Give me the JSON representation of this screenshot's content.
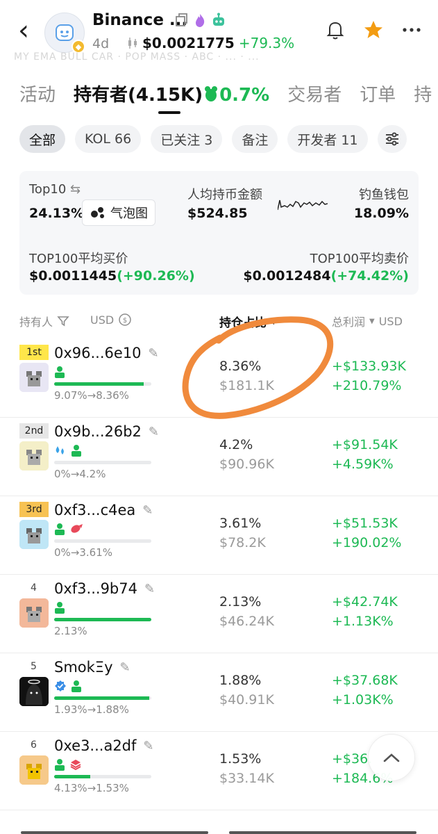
{
  "header": {
    "token_name": "Binance ...",
    "age": "4d",
    "price": "$0.0021775",
    "change": "+79.3%",
    "ghost_text": "MY EMA BULL CAR · POP MASS · ABC · ... · ..."
  },
  "tabs": [
    {
      "label": "活动"
    },
    {
      "label": "持有者(4.15K)",
      "pct": "0.7%"
    },
    {
      "label": "交易者"
    },
    {
      "label": "订单"
    },
    {
      "label": "持"
    }
  ],
  "chips": [
    {
      "label": "全部"
    },
    {
      "label": "KOL 66"
    },
    {
      "label": "已关注 3"
    },
    {
      "label": "备注"
    },
    {
      "label": "开发者 11"
    }
  ],
  "stats": {
    "top10_label": "Top10",
    "top10_value": "24.13%",
    "bubble_label": "气泡图",
    "avg_hold_label": "人均持币金额",
    "avg_hold_value": "$524.85",
    "phishing_label": "钓鱼钱包",
    "phishing_value": "18.09%",
    "top100_buy_label": "TOP100平均买价",
    "top100_buy_value": "$0.0011445",
    "top100_buy_change": "(+90.26%)",
    "top100_sell_label": "TOP100平均卖价",
    "top100_sell_value": "$0.0012484",
    "top100_sell_change": "(+74.42%)"
  },
  "table_header": {
    "holder": "持有人",
    "usd": "USD",
    "position": "持仓占比",
    "pnl": "总利润",
    "pnl_usd": "USD"
  },
  "rows": [
    {
      "rank": "1st",
      "address": "0x96...6e10",
      "change": "9.07%→8.36%",
      "hold_pct": "8.36%",
      "hold_usd": "$181.1K",
      "pnl": "+$133.93K",
      "pnl_pct": "+210.79%",
      "bar": 0.92
    },
    {
      "rank": "2nd",
      "address": "0x9b...26b2",
      "change": "0%→4.2%",
      "hold_pct": "4.2%",
      "hold_usd": "$90.96K",
      "pnl": "+$91.54K",
      "pnl_pct": "+4.59K%",
      "bar": 0.0
    },
    {
      "rank": "3rd",
      "address": "0xf3...c4ea",
      "change": "0%→3.61%",
      "hold_pct": "3.61%",
      "hold_usd": "$78.2K",
      "pnl": "+$51.53K",
      "pnl_pct": "+190.02%",
      "bar": 0.0
    },
    {
      "rank": "4",
      "address": "0xf3...9b74",
      "change": "2.13%",
      "hold_pct": "2.13%",
      "hold_usd": "$46.24K",
      "pnl": "+$42.74K",
      "pnl_pct": "+1.13K%",
      "bar": 1.0
    },
    {
      "rank": "5",
      "address": "SmokΞy",
      "change": "1.93%→1.88%",
      "hold_pct": "1.88%",
      "hold_usd": "$40.91K",
      "pnl": "+$37.68K",
      "pnl_pct": "+1.03K%",
      "bar": 0.98
    },
    {
      "rank": "6",
      "address": "0xe3...a2df",
      "change": "4.13%→1.53%",
      "hold_pct": "1.53%",
      "hold_usd": "$33.14K",
      "pnl": "+$36.",
      "pnl_pct": "+184.6%",
      "bar": 0.37
    }
  ],
  "colors": {
    "accent_green": "#1db954",
    "star": "#f39c12",
    "annotation": "#f08a3c"
  }
}
